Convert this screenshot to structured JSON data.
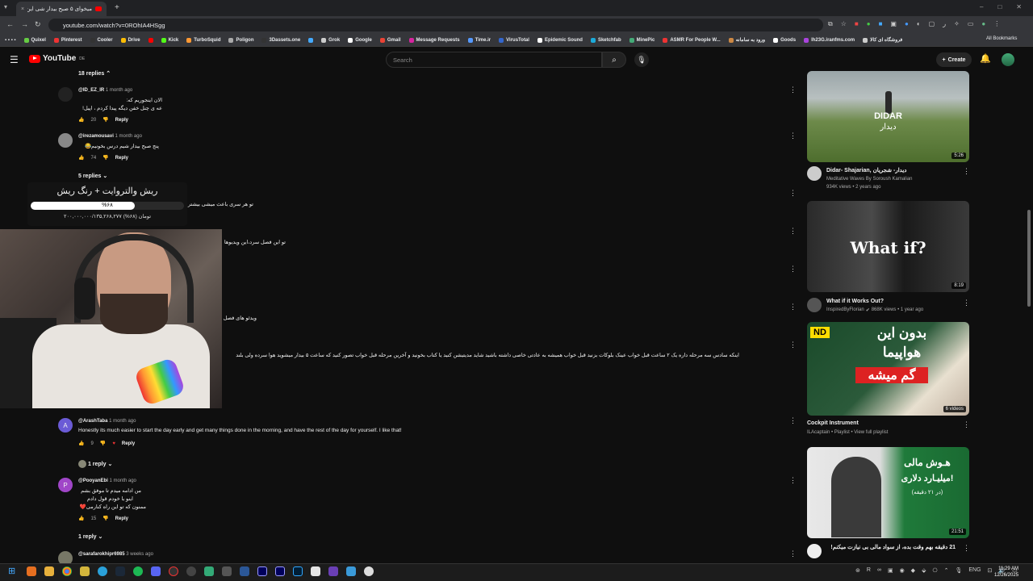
{
  "browser": {
    "tab_title": "میخوای ۵ صبح بیدار شی این ...",
    "url": "youtube.com/watch?v=0ROhIA4HSgg",
    "bookmarks": [
      "Quixel",
      "Pinterest",
      "Cooler",
      "Drive",
      "",
      "Kick",
      "TurboSquid",
      "Poligon",
      "3Dassets.one",
      "",
      "Grok",
      "Google",
      "Gmail",
      "Message Requests",
      "Time.ir",
      "VirusTotal",
      "Epidemic Sound",
      "Sketchfab",
      "MinePic",
      "ASMR For People W...",
      "ورود به سامانه",
      "Goods",
      "lh23G.iranfms.com",
      "فروشگاه ای كالا",
      "All Bookmarks"
    ]
  },
  "header": {
    "logo_text": "YouTube",
    "logo_region": "DE",
    "search_placeholder": "Search",
    "create_label": "Create"
  },
  "comments": {
    "top_replies_toggle": "18 replies",
    "c1": {
      "author": "@ID_EZ_IR",
      "time": "1 month ago",
      "line1": "الان اینجوریم که:",
      "line2": "عه ی چنل خفن دیگه پیدا کردم ، اپیل!",
      "likes": "20",
      "reply": "Reply"
    },
    "c2": {
      "author": "@irezamousavi",
      "time": "1 month ago",
      "line1": "پنج صبح بیدار شیم درس بخونیم😂",
      "likes": "74",
      "reply": "Reply"
    },
    "replies_toggle_2": "5 replies",
    "partial1": "تو هر سری باعث میشی بیشتر",
    "partial2": "تو این فصل سرد،این ویدیوها",
    "partial3": "ویدئو های فصل",
    "long_line": "اینکه سادس سه مرحله داره یک ۲ ساعت قبل خواب عینک بلوکات بزنید قبل خواب همیشه به عادتی خاصی داشته باشید شاید مدیتیشن کنید یا کتاب بخونید و آخرین مرحله قبل خواب تصور کنید که ساعت ۵ بیدار میشوید هوا سرده ولی بلند",
    "c3": {
      "author": "@ArashTaba",
      "time": "1 month ago",
      "text": "Honestly its much easier to start the day early and get many things done in the morning, and have the rest of the day for yourself. I like that!",
      "likes": "9",
      "reply": "Reply",
      "replies_toggle": "1 reply"
    },
    "c4": {
      "author": "@PooyanEbi",
      "time": "1 month ago",
      "line1": "من ادامه میدم تا موفق بشم",
      "line2": "اینو با خودم قول دادم",
      "line3": "ممنون که تو این راه کنارمی❤️",
      "likes": "15",
      "reply": "Reply",
      "replies_toggle": "1 reply"
    },
    "c5": {
      "author": "@sarafarokhipr6985",
      "time": "3 weeks ago"
    }
  },
  "overlay": {
    "title": "ریش والتروایت + رنگ ریش",
    "percent_text": "%۶۸",
    "progress": 0.68,
    "amount": "۲۰۰,۰۰۰,۰۰۰/۱۳۵,۲۶۸,۲۷۷ تومان (۶۸%)"
  },
  "sidebar": {
    "v1": {
      "thumb_title": "DIDAR",
      "thumb_sub": "دیدار",
      "duration": "5:26",
      "title": "Didar- Shajarian, دیدار- شجریان",
      "channel": "Meditative Waves By Soroush Kamalian",
      "meta": "934K views • 2 years ago"
    },
    "v2": {
      "thumb_title": "What if?",
      "duration": "8:19",
      "title": "What if it Works Out?",
      "channel": "InspiredByFlorian",
      "meta": "868K views • 1 year ago"
    },
    "v3": {
      "thumb_line1": "بدون این",
      "thumb_line2": "هواپیما",
      "thumb_line3": "گم میشه",
      "badge": "ND",
      "duration": "6 videos",
      "title": "Cockpit Instrument",
      "channel": "ILAcaptain • Playlist • View full playlist"
    },
    "v4": {
      "thumb_line1": "هـوش مالی",
      "thumb_line2": "میلیـارد دلاری!",
      "thumb_line3": "(در ۲۱ دقیقه)",
      "duration": "21:51",
      "title": "21 دقیقه بهم وقت بده، از سواد مالی بی نیازت میکنم!"
    }
  },
  "taskbar": {
    "time": "11:29 AM",
    "date": "12/26/2025"
  },
  "colors": {
    "background": "#0f0f0f",
    "youtube_red": "#ff0000",
    "text_secondary": "#aaaaaa"
  }
}
